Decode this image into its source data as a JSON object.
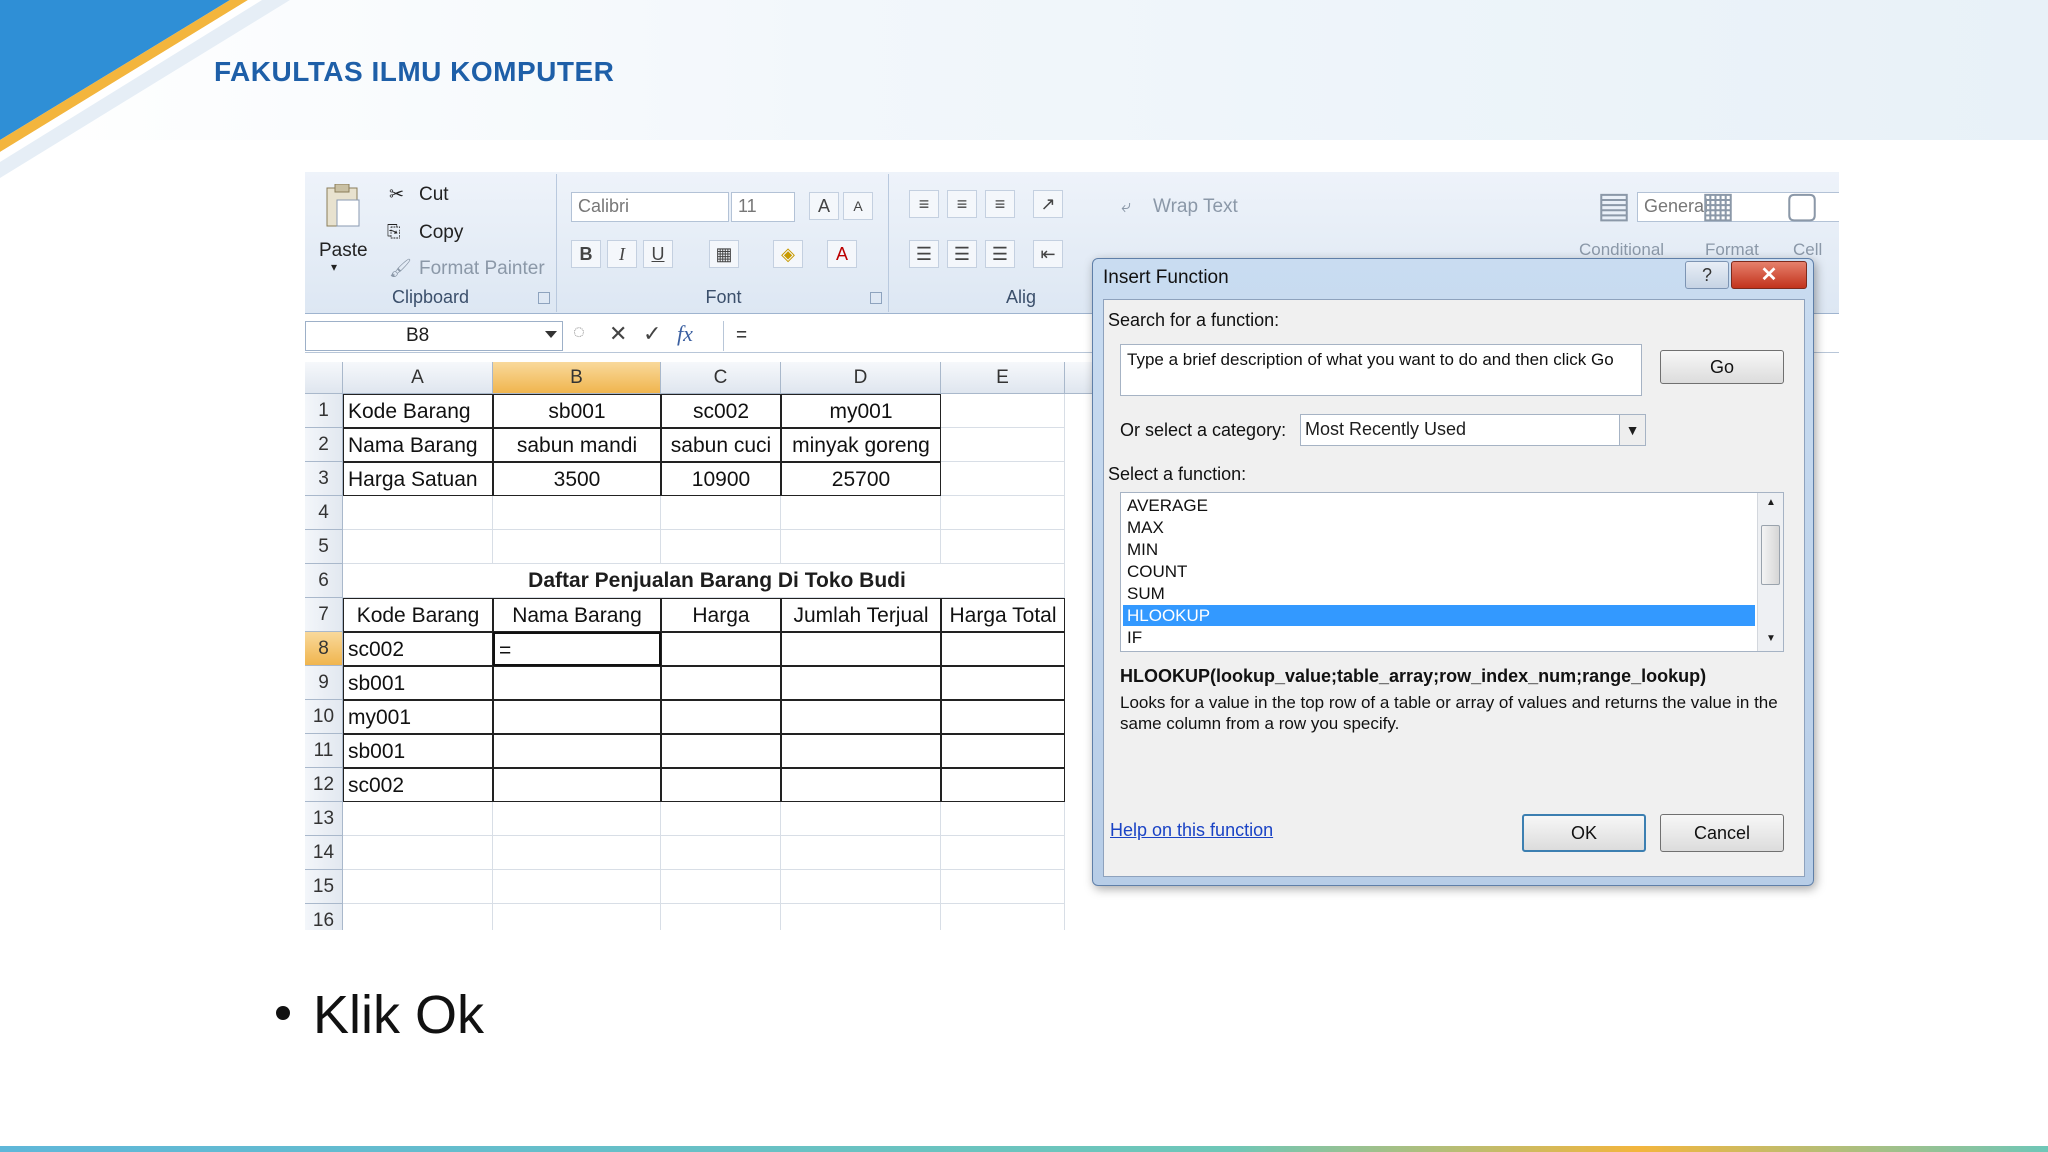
{
  "slide": {
    "brand": "FAKULTAS ILMU KOMPUTER",
    "bullet": "Klik Ok",
    "colors": {
      "brand": "#1e5fa8",
      "deco_blue": "#2f8fd6",
      "deco_orange": "#f3b53d"
    }
  },
  "ribbon": {
    "clipboard": {
      "paste": "Paste",
      "cut": "Cut",
      "copy": "Copy",
      "format_painter": "Format Painter",
      "label": "Clipboard"
    },
    "font": {
      "family": "Calibri",
      "size": "11",
      "label": "Font",
      "bold": "B",
      "italic": "I",
      "underline": "U"
    },
    "alignment": {
      "label": "Alig",
      "wrap_text": "Wrap Text"
    },
    "number": {
      "format": "General"
    },
    "styles": {
      "conditional": "Conditional",
      "format": "Format",
      "cell": "Cell"
    }
  },
  "formula_bar": {
    "namebox": "B8",
    "formula": "="
  },
  "sheet": {
    "columns": [
      "A",
      "B",
      "C",
      "D",
      "E"
    ],
    "rows": [
      "1",
      "2",
      "3",
      "4",
      "5",
      "6",
      "7",
      "8",
      "9",
      "10",
      "11",
      "12",
      "13",
      "14",
      "15",
      "16"
    ],
    "items": {
      "r1": [
        "Kode Barang",
        "sb001",
        "sc002",
        "my001"
      ],
      "r2": [
        "Nama Barang",
        "sabun mandi",
        "sabun cuci",
        "minyak goreng"
      ],
      "r3": [
        "Harga Satuan",
        "3500",
        "10900",
        "25700"
      ]
    },
    "title": "Daftar Penjualan Barang Di Toko Budi",
    "table_headers": [
      "Kode Barang",
      "Nama Barang",
      "Harga",
      "Jumlah Terjual",
      "Harga Total"
    ],
    "codes": [
      "sc002",
      "sb001",
      "my001",
      "sb001",
      "sc002"
    ],
    "active_input": "="
  },
  "dialog": {
    "title": "Insert Function",
    "help_glyph": "?",
    "close_glyph": "✕",
    "search_label": "Search for a function:",
    "search_text": "Type a brief description of what you want to do and then click Go",
    "go": "Go",
    "category_label": "Or select a category:",
    "category_value": "Most Recently Used",
    "select_label": "Select a function:",
    "functions": [
      "AVERAGE",
      "MAX",
      "MIN",
      "COUNT",
      "SUM",
      "HLOOKUP",
      "IF"
    ],
    "selected_function": "HLOOKUP",
    "signature": "HLOOKUP(lookup_value;table_array;row_index_num;range_lookup)",
    "description": "Looks for a value in the top row of a table or array of values and returns the value in the same column from a row you specify.",
    "help_link": "Help on this function",
    "ok": "OK",
    "cancel": "Cancel"
  }
}
